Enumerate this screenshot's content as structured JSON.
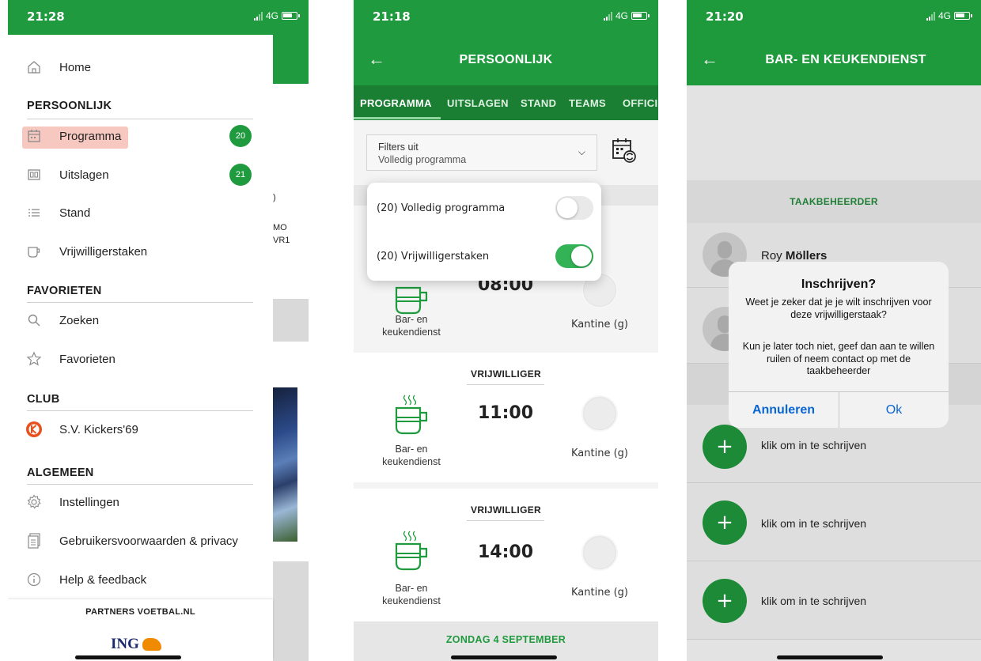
{
  "screen1": {
    "time": "21:28",
    "network": "4G",
    "menu": {
      "home": "Home",
      "sections": {
        "personal": "PERSOONLIJK",
        "favorites": "FAVORIETEN",
        "club": "CLUB",
        "general": "ALGEMEEN"
      },
      "personal_items": [
        {
          "label": "Programma",
          "icon": "calendar-icon",
          "badge": "20",
          "active": true
        },
        {
          "label": "Uitslagen",
          "icon": "scoreboard-icon",
          "badge": "21"
        },
        {
          "label": "Stand",
          "icon": "list-icon"
        },
        {
          "label": "Vrijwilligerstaken",
          "icon": "cup-icon"
        }
      ],
      "favorite_items": [
        {
          "label": "Zoeken",
          "icon": "search-icon"
        },
        {
          "label": "Favorieten",
          "icon": "star-icon"
        }
      ],
      "club_items": [
        {
          "label": "S.V. Kickers'69",
          "icon": "club-logo-icon"
        }
      ],
      "general_items": [
        {
          "label": "Instellingen",
          "icon": "gear-icon"
        },
        {
          "label": "Gebruikersvoorwaarden & privacy",
          "icon": "document-icon"
        },
        {
          "label": "Help & feedback",
          "icon": "info-icon"
        }
      ]
    },
    "partners_label": "PARTNERS VOETBAL.NL",
    "partner_logo_text": "ING",
    "background_text": [
      "MO",
      "VR1"
    ]
  },
  "screen2": {
    "time": "21:18",
    "network": "4G",
    "title": "PERSOONLIJK",
    "tabs": [
      "PROGRAMMA",
      "UITSLAGEN",
      "STAND",
      "TEAMS",
      "OFFICI"
    ],
    "active_tab": "PROGRAMMA",
    "filter": {
      "line1": "Filters uit",
      "line2": "Volledig programma"
    },
    "popover": [
      {
        "label": "(20) Volledig programma",
        "on": false
      },
      {
        "label": "(20) Vrijwilligerstaken",
        "on": true
      }
    ],
    "tasks": [
      {
        "heading": "",
        "time": "08:00",
        "task_line1": "Bar- en",
        "task_line2": "keukendienst",
        "location": "Kantine (g)"
      },
      {
        "heading": "VRIJWILLIGER",
        "time": "11:00",
        "task_line1": "Bar- en",
        "task_line2": "keukendienst",
        "location": "Kantine (g)"
      },
      {
        "heading": "VRIJWILLIGER",
        "time": "14:00",
        "task_line1": "Bar- en",
        "task_line2": "keukendienst",
        "location": "Kantine (g)"
      }
    ],
    "date_header": "ZONDAG 4 SEPTEMBER"
  },
  "screen3": {
    "time": "21:20",
    "network": "4G",
    "title": "BAR- EN KEUKENDIENST",
    "section": "TAAKBEHEERDER",
    "manager_first": "Roy",
    "manager_last": "Möllers",
    "signup_label": "klik om in te schrijven",
    "dialog": {
      "title": "Inschrijven?",
      "message": "Weet je zeker dat je je wilt inschrijven voor deze vrijwilligerstaak?",
      "message2": "Kun je later toch niet, geef dan aan te willen ruilen of neem contact op met de taakbeheerder",
      "cancel": "Annuleren",
      "ok": "Ok"
    }
  }
}
